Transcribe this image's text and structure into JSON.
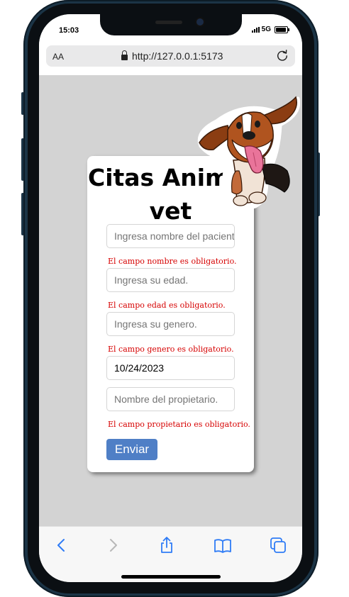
{
  "status_bar": {
    "time": "15:03",
    "network": "5G"
  },
  "browser": {
    "text_size_label": "AA",
    "url": "http://127.0.0.1:5173"
  },
  "form": {
    "title": "Citas Animal vet",
    "fields": [
      {
        "placeholder": "Ingresa nombre del paciente",
        "value": "",
        "error": "El campo nombre es obligatorio."
      },
      {
        "placeholder": "Ingresa su edad.",
        "value": "",
        "error": "El campo edad es obligatorio."
      },
      {
        "placeholder": "Ingresa su genero.",
        "value": "",
        "error": "El campo genero es obligatorio."
      },
      {
        "placeholder": "",
        "value": "10/24/2023",
        "error": ""
      },
      {
        "placeholder": "Nombre del propietario.",
        "value": "",
        "error": "El campo propietario es obligatorio."
      }
    ],
    "submit_label": "Enviar"
  },
  "toolbar_icons": [
    "back-icon",
    "forward-icon",
    "share-icon",
    "bookmarks-icon",
    "tabs-icon"
  ],
  "colors": {
    "accent": "#4f7fc6",
    "error": "#d60000",
    "page_bg": "#d3d3d3",
    "ios_blue": "#2f7cf6"
  }
}
